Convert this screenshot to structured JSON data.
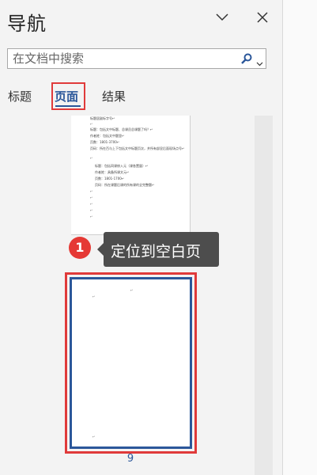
{
  "panel": {
    "title": "导航",
    "chevron_icon": "chevron-down-icon",
    "close_icon": "close-icon"
  },
  "search": {
    "placeholder": "在文档中搜索",
    "value": "",
    "search_icon": "search-icon",
    "dropdown_icon": "chevron-down-icon"
  },
  "tabs": [
    {
      "label": "标题",
      "active": false
    },
    {
      "label": "页面",
      "active": true
    },
    {
      "label": "结果",
      "active": false
    }
  ],
  "thumbnails": {
    "page8_lines": [
      "标题居副标字号↵",
      "↵",
      "标题：包括文中标题、总课员总课题了吗？↵",
      "作者姓：包括文中题里↵",
      "页数：1801-3700↵",
      "页码：所在百与上下包括文中标题页次，并所有部显后面现场点号↵",
      "↵",
      "标题：包括同课修入元（课各置量）↵",
      "作者姓：具备所课文元↵",
      "页数：1801-1700↵",
      "页码：所在课题后课的所有课的全完整题↵"
    ],
    "page9_number": "9"
  },
  "tooltip": {
    "step": "1",
    "text": "定位到空白页"
  },
  "colors": {
    "accent": "#2b579a",
    "highlight": "#e03a3a",
    "badge": "#e53935",
    "tooltip_bg": "#4d4d4d"
  }
}
